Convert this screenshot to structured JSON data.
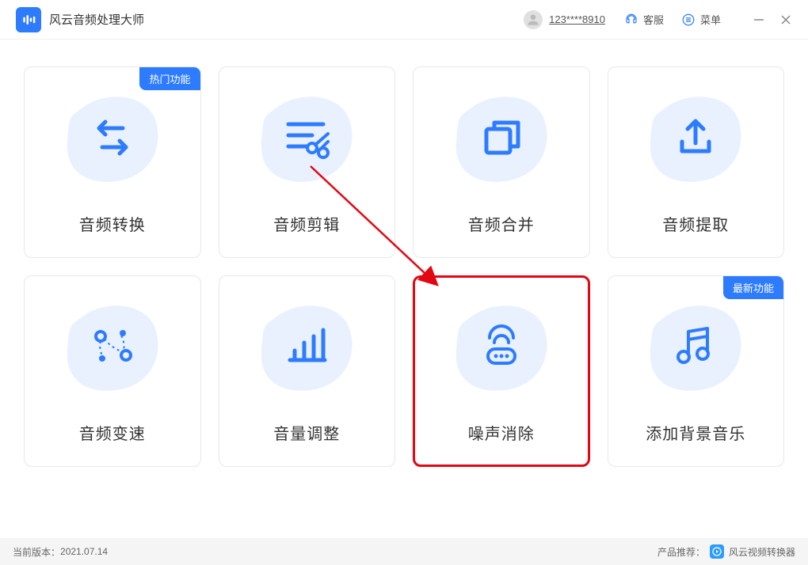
{
  "app_title": "风云音频处理大师",
  "header": {
    "username": "123****8910",
    "service": "客服",
    "menu": "菜单"
  },
  "badges": {
    "hot": "热门功能",
    "new": "最新功能"
  },
  "cards": [
    {
      "label": "音频转换"
    },
    {
      "label": "音频剪辑"
    },
    {
      "label": "音频合并"
    },
    {
      "label": "音频提取"
    },
    {
      "label": "音频变速"
    },
    {
      "label": "音量调整"
    },
    {
      "label": "噪声消除"
    },
    {
      "label": "添加背景音乐"
    }
  ],
  "footer": {
    "version_label": "当前版本：",
    "version": "2021.07.14",
    "recommend_label": "产品推荐：",
    "recommend_name": "风云视频转换器"
  }
}
